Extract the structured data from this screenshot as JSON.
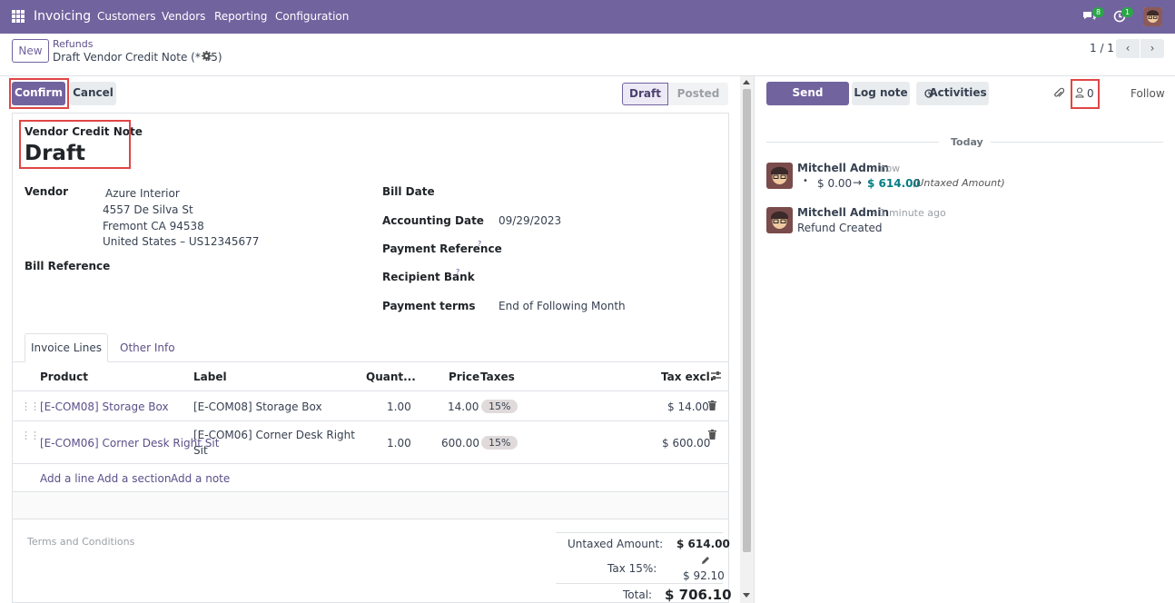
{
  "topnav": {
    "brand": "Invoicing",
    "menu": [
      "Customers",
      "Vendors",
      "Reporting",
      "Configuration"
    ],
    "messages_count": "8",
    "activities_count": "1"
  },
  "control_panel": {
    "new_label": "New",
    "breadcrumb_parent": "Refunds",
    "record_title": "Draft Vendor Credit Note (* 45)",
    "pager": "1 / 1"
  },
  "actions": {
    "confirm_label": "Confirm",
    "cancel_label": "Cancel",
    "status_draft": "Draft",
    "status_posted": "Posted"
  },
  "form": {
    "doc_type": "Vendor Credit Note",
    "doc_name": "Draft",
    "vendor_label": "Vendor",
    "vendor_name": "Azure Interior",
    "vendor_address": [
      "4557 De Silva St",
      "Fremont CA 94538",
      "United States – US12345677"
    ],
    "bill_reference_label": "Bill Reference",
    "bill_date_label": "Bill Date",
    "accounting_date_label": "Accounting Date",
    "accounting_date": "09/29/2023",
    "payment_reference_label": "Payment Reference",
    "recipient_bank_label": "Recipient Bank",
    "help_mark": "?",
    "payment_terms_label": "Payment terms",
    "payment_terms": "End of Following Month"
  },
  "tabs": [
    "Invoice Lines",
    "Other Info"
  ],
  "lines": {
    "headers": {
      "product": "Product",
      "label": "Label",
      "quantity": "Quant...",
      "price": "Price",
      "taxes": "Taxes",
      "tax_excl": "Tax excl."
    },
    "rows": [
      {
        "product": "[E-COM08] Storage Box",
        "label": "[E-COM08] Storage Box",
        "label2": "",
        "quantity": "1.00",
        "price": "14.00",
        "tax": "15%",
        "subtotal": "$ 14.00"
      },
      {
        "product": "[E-COM06] Corner Desk Right Sit",
        "label": "[E-COM06] Corner Desk Right",
        "label2": "Sit",
        "quantity": "1.00",
        "price": "600.00",
        "tax": "15%",
        "subtotal": "$ 600.00"
      }
    ],
    "add_line": "Add a line",
    "add_section": "Add a section",
    "add_note": "Add a note"
  },
  "totals": {
    "terms_placeholder": "Terms and Conditions",
    "untaxed_label": "Untaxed Amount:",
    "untaxed_value": "$ 614.00",
    "tax_label": "Tax 15%:",
    "tax_value": "$ 92.10",
    "total_label": "Total:",
    "total_value": "$ 706.10"
  },
  "chatter": {
    "send_message": "Send message",
    "log_note": "Log note",
    "activities": "Activities",
    "followers_count": "0",
    "follow": "Follow",
    "date_separator": "Today",
    "messages": [
      {
        "author": "Mitchell Admin",
        "time": "- now",
        "old_value": "$ 0.00",
        "arrow": "→",
        "new_value": "$ 614.00",
        "field": "(Untaxed Amount)"
      },
      {
        "author": "Mitchell Admin",
        "time": "- 1 minute ago",
        "body": "Refund Created"
      }
    ]
  },
  "colors": {
    "brand": "#71639e",
    "highlight": "#e04646",
    "link": "#017e84",
    "badge": "#28a745"
  }
}
